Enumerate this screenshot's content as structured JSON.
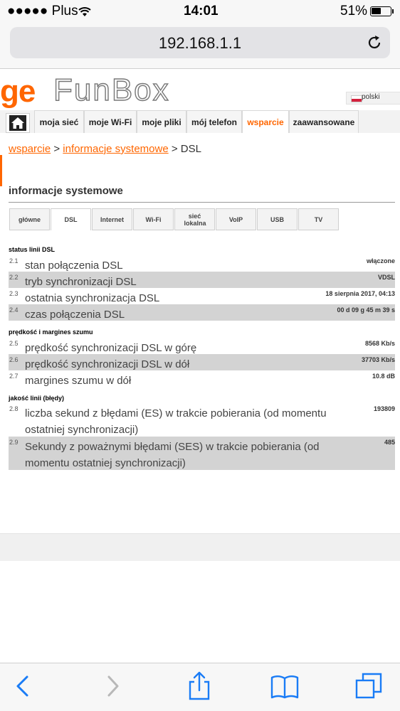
{
  "status": {
    "carrier": "●●●●● Plus",
    "time": "14:01",
    "battery": "51%"
  },
  "url": "192.168.1.1",
  "brand": {
    "prefix": "ge",
    "name": "FunBox"
  },
  "language": "polski",
  "nav": [
    "moja sieć",
    "moje Wi-Fi",
    "moje pliki",
    "mój telefon",
    "wsparcie",
    "zaawansowane"
  ],
  "breadcrumb": {
    "link1": "wsparcie",
    "sep1": " > ",
    "link2": "informacje systemowe",
    "sep2": " > ",
    "current": "DSL"
  },
  "section_title": "informacje systemowe",
  "tabs": [
    "główne",
    "DSL",
    "Internet",
    "Wi-Fi",
    "sieć lokalna",
    "VoIP",
    "USB",
    "TV"
  ],
  "groups": {
    "status": "status linii DSL",
    "speed": "prędkość i margines szumu",
    "quality": "jakość linii (błędy)"
  },
  "rows": [
    {
      "num": "2.1",
      "label": "stan połączenia DSL",
      "value": "włączone"
    },
    {
      "num": "2.2",
      "label": "tryb synchronizacji DSL",
      "value": "VDSL"
    },
    {
      "num": "2.3",
      "label": "ostatnia synchronizacja DSL",
      "value": "18 sierpnia 2017, 04:13"
    },
    {
      "num": "2.4",
      "label": "czas połączenia DSL",
      "value": "00 d 09 g 45 m 39 s"
    },
    {
      "num": "2.5",
      "label": "prędkość synchronizacji DSL w górę",
      "value": "8568 Kb/s"
    },
    {
      "num": "2.6",
      "label": "prędkość synchronizacji DSL w dół",
      "value": "37703 Kb/s"
    },
    {
      "num": "2.7",
      "label": "margines szumu w dół",
      "value": "10.8 dB"
    },
    {
      "num": "2.8",
      "label": "liczba sekund z błędami (ES) w trakcie pobierania (od momentu ostatniej synchronizacji)",
      "value": "193809"
    },
    {
      "num": "2.9",
      "label": "Sekundy z poważnymi błędami (SES) w trakcie pobierania (od momentu ostatniej synchronizacji)",
      "value": "485"
    }
  ],
  "colors": {
    "accent": "#ff6600",
    "row_gray": "#d3d3d3",
    "ios_blue": "#1a7cf6"
  }
}
